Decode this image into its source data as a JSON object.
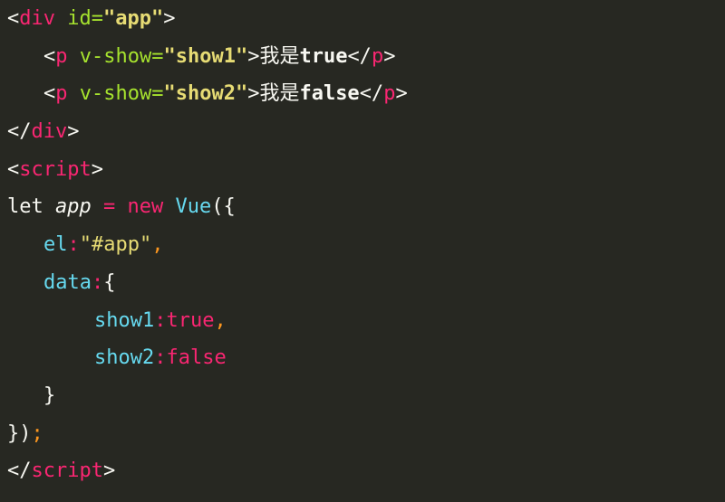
{
  "code": {
    "l1": {
      "open": "<",
      "tag": "div",
      "attr": " id=",
      "val": "\"app\"",
      "close": ">"
    },
    "l2": {
      "open": "<",
      "tag": "p",
      "attr": " v-show=",
      "val": "\"show1\"",
      "close": ">",
      "cjk": "我是",
      "text": "true",
      "end_open": "</",
      "end_tag": "p",
      "end_close": ">"
    },
    "l3": {
      "open": "<",
      "tag": "p",
      "attr": " v-show=",
      "val": "\"show2\"",
      "close": ">",
      "cjk": "我是",
      "text": "false",
      "end_open": "</",
      "end_tag": "p",
      "end_close": ">"
    },
    "l4": {
      "open": "</",
      "tag": "div",
      "close": ">"
    },
    "l5": {
      "open": "<",
      "tag": "script",
      "close": ">"
    },
    "l6": {
      "kw1": "let ",
      "var": "app",
      "eq": " = ",
      "kw2": "new",
      "sp": " ",
      "cls": "Vue",
      "paren": "({"
    },
    "l7": {
      "prop": "el",
      "colon": ":",
      "str": "\"#app\"",
      "comma": ","
    },
    "l8": {
      "prop": "data",
      "colon": ":",
      "brace": "{"
    },
    "l9": {
      "prop": "show1",
      "colon": ":",
      "val": "true",
      "comma": ","
    },
    "l10": {
      "prop": "show2",
      "colon": ":",
      "val": "false"
    },
    "l11": {
      "brace": "}"
    },
    "l12": {
      "close": "})",
      "semi": ";"
    },
    "l13": {
      "open": "</",
      "tag": "script",
      "close": ">"
    }
  },
  "colors": {
    "background": "#272822",
    "tag": "#f92672",
    "attribute": "#a6e22e",
    "string": "#e6db74",
    "property": "#66d9ef",
    "text": "#f8f8f2"
  }
}
